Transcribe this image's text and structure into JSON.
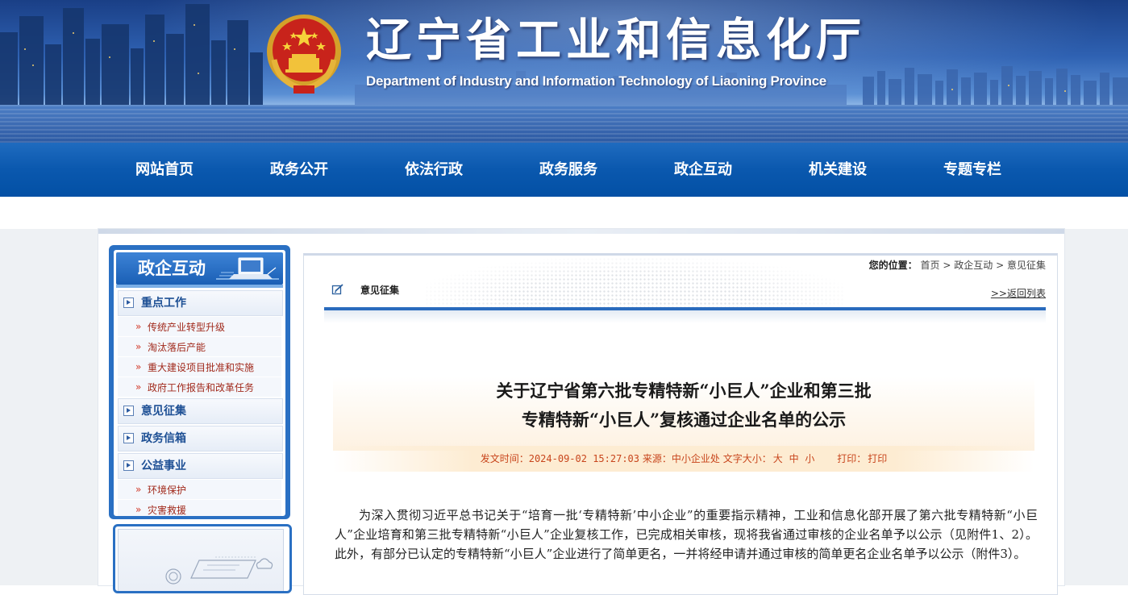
{
  "header": {
    "title_cn": "辽宁省工业和信息化厅",
    "title_en": "Department of Industry and Information Technology of Liaoning Province"
  },
  "nav": {
    "items": [
      "网站首页",
      "政务公开",
      "依法行政",
      "政务服务",
      "政企互动",
      "机关建设",
      "专题专栏"
    ]
  },
  "sidebar": {
    "title": "政企互动",
    "sections": [
      {
        "label": "重点工作",
        "children": [
          "传统产业转型升级",
          "淘汰落后产能",
          "重大建设项目批准和实施",
          "政府工作报告和改革任务"
        ]
      },
      {
        "label": "意见征集",
        "children": []
      },
      {
        "label": "政务信箱",
        "children": []
      },
      {
        "label": "公益事业",
        "children": [
          "环境保护",
          "灾害救援"
        ]
      }
    ],
    "bullet": "»"
  },
  "breadcrumb": {
    "prefix": "您的位置：",
    "items": [
      "首页",
      "政企互动",
      "意见征集"
    ],
    "separator": ">"
  },
  "column": {
    "name": "意见征集",
    "back_link": ">>返回列表"
  },
  "article": {
    "title_line1": "关于辽宁省第六批专精特新“小巨人”企业和第三批",
    "title_line2": "专精特新“小巨人”复核通过企业名单的公示",
    "meta": {
      "date_label": "发文时间：",
      "date": "2024-09-02 15:27:03",
      "source_label": "来源：",
      "source": "中小企业处",
      "font_label": "文字大小：",
      "font_large": "大",
      "font_medium": "中",
      "font_small": "小",
      "print_label": "打印：",
      "print": "打印"
    },
    "body": "为深入贯彻习近平总书记关于“培育一批‘专精特新’中小企业”的重要指示精神，工业和信息化部开展了第六批专精特新“小巨人”企业培育和第三批专精特新“小巨人”企业复核工作，已完成相关审核，现将我省通过审核的企业名单予以公示（见附件1、2）。此外，有部分已认定的专精特新“小巨人”企业进行了简单更名，一并将经申请并通过审核的简单更名企业名单予以公示（附件3）。"
  },
  "colors": {
    "nav_blue": "#0a58ae",
    "sidebar_blue": "#2a70c3",
    "link_red": "#a12a1c",
    "meta_orange": "#c8451c"
  },
  "icons": [
    "national-emblem-icon",
    "laptop-icon",
    "edit-icon",
    "expand-arrow-icon"
  ]
}
